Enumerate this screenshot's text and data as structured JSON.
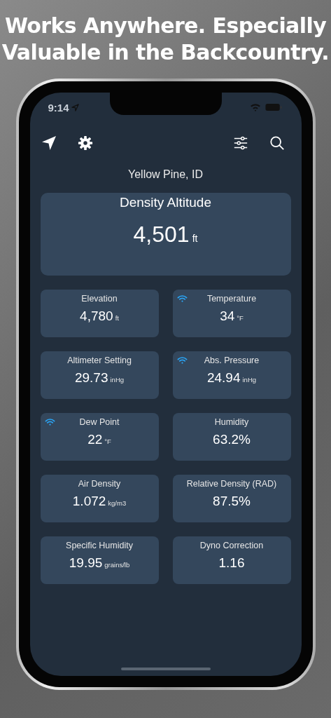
{
  "headline": [
    "Works Anywhere. Especially",
    "Valuable in the Backcountry."
  ],
  "status_bar": {
    "time": "9:14"
  },
  "location": "Yellow Pine, ID",
  "hero": {
    "title": "Density Altitude",
    "value": "4,501",
    "unit": "ft"
  },
  "tiles": [
    {
      "label": "Elevation",
      "value": "4,780",
      "unit": "ft",
      "live": false
    },
    {
      "label": "Temperature",
      "value": "34",
      "unit": "°F",
      "live": true
    },
    {
      "label": "Altimeter Setting",
      "value": "29.73",
      "unit": "inHg",
      "live": false
    },
    {
      "label": "Abs. Pressure",
      "value": "24.94",
      "unit": "inHg",
      "live": true
    },
    {
      "label": "Dew Point",
      "value": "22",
      "unit": "°F",
      "live": true
    },
    {
      "label": "Humidity",
      "value": "63.2%",
      "live": false
    },
    {
      "label": "Air Density",
      "value": "1.072",
      "unit": "kg/m3",
      "live": false
    },
    {
      "label": "Relative Density (RAD)",
      "value": "87.5%",
      "live": false
    },
    {
      "label": "Specific Humidity",
      "value": "19.95",
      "unit": "grains/lb",
      "live": false
    },
    {
      "label": "Dyno Correction",
      "value": "1.16",
      "live": false
    }
  ]
}
